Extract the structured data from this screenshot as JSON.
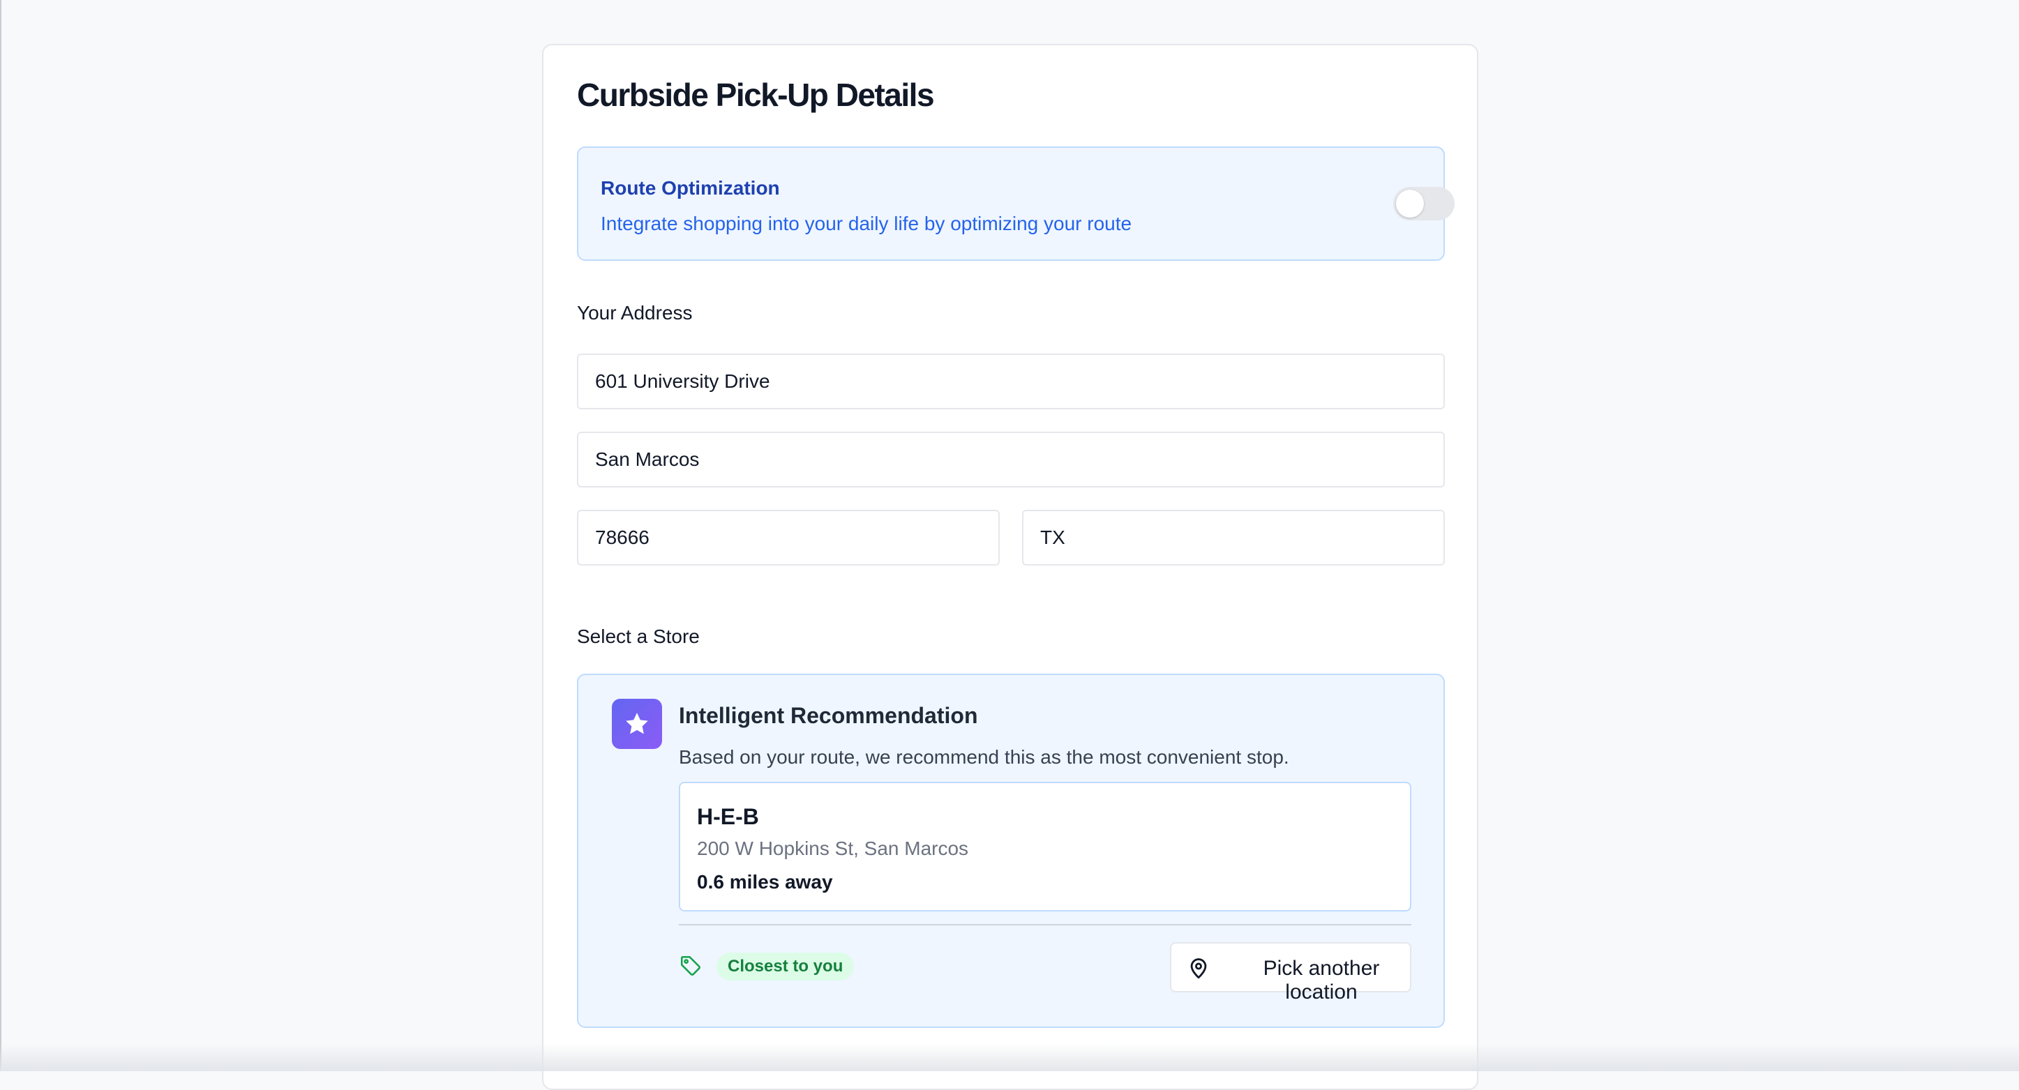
{
  "page": {
    "title": "Curbside Pick-Up Details"
  },
  "route_optimization": {
    "title": "Route Optimization",
    "description": "Integrate shopping into your daily life by optimizing your route",
    "enabled": false
  },
  "address": {
    "label": "Your Address",
    "street": "601 University Drive",
    "city": "San Marcos",
    "zip": "78666",
    "state": "TX"
  },
  "store": {
    "label": "Select a Store",
    "recommendation_title": "Intelligent Recommendation",
    "recommendation_text": "Based on your route, we recommend this as the most convenient stop.",
    "name": "H-E-B",
    "address": "200 W Hopkins St, San Marcos",
    "distance": "0.6 miles away",
    "badge": "Closest to you",
    "pick_another_label": "Pick another location"
  },
  "icons": {
    "recommendation": "star-icon",
    "badge": "tag-icon",
    "pick_another": "map-pin-icon"
  },
  "colors": {
    "accent_blue": "#2563eb",
    "accent_blue_dark": "#1e40af",
    "panel_bg": "#eff6ff",
    "panel_border": "#bfdbfe",
    "badge_green": "#15803d",
    "badge_green_bg": "#dcfce7",
    "star_gradient_start": "#6366f1",
    "star_gradient_end": "#8b5cf6"
  }
}
